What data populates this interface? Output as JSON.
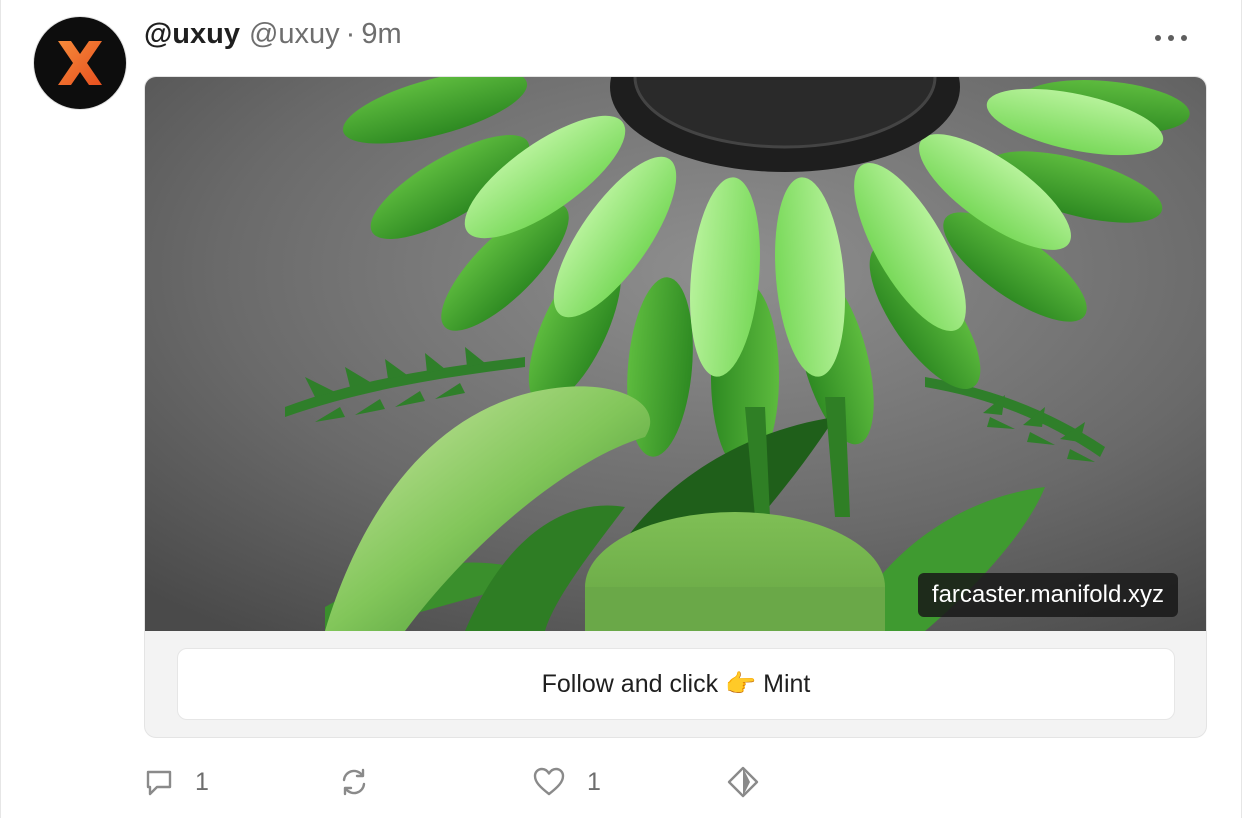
{
  "post": {
    "display_name": "@uxuy",
    "handle": "@uxuy",
    "separator": "·",
    "time": "9m",
    "avatar_icon": "uxuy-logo-icon",
    "more_icon": "more-horizontal-icon"
  },
  "frame": {
    "domain": "farcaster.manifold.xyz",
    "button_label_pre": "Follow and click ",
    "button_emoji": "👉",
    "button_label_post": " Mint",
    "image_icon": "green-flower-nft-image"
  },
  "actions": {
    "replies": {
      "icon": "comment-icon",
      "count": "1"
    },
    "recasts": {
      "icon": "recast-icon",
      "count": ""
    },
    "likes": {
      "icon": "heart-icon",
      "count": "1"
    },
    "tip": {
      "icon": "diamond-icon"
    }
  },
  "colors": {
    "accent_orange": "#f26b2a",
    "avatar_bg": "#0d0d0d",
    "muted_text": "#6e6e6e",
    "icon_gray": "#8a8a8a",
    "frame_bg": "#f3f3f3"
  }
}
